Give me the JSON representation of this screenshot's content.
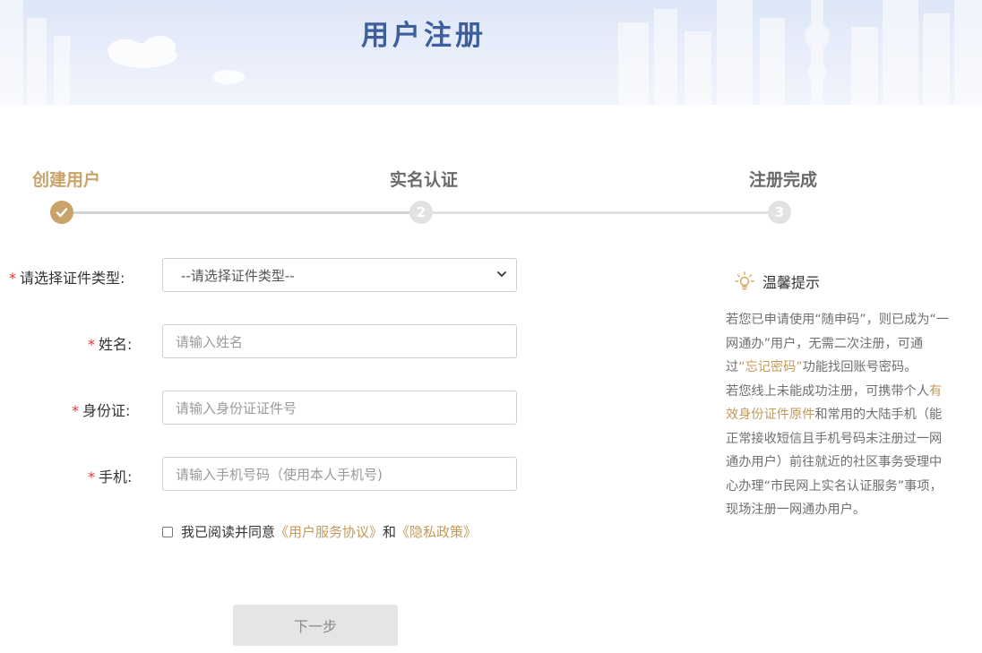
{
  "header": {
    "title": "用户注册"
  },
  "steps": [
    {
      "label": "创建用户",
      "num": "1",
      "state": "done"
    },
    {
      "label": "实名认证",
      "num": "2",
      "state": "pending"
    },
    {
      "label": "注册完成",
      "num": "3",
      "state": "pending"
    }
  ],
  "form": {
    "required_mark": "*",
    "id_type": {
      "label": "请选择证件类型:",
      "value": "--请选择证件类型--"
    },
    "name": {
      "label": "姓名:",
      "placeholder": "请输入姓名"
    },
    "id_number": {
      "label": "身份证:",
      "placeholder": "请输入身份证证件号"
    },
    "phone": {
      "label": "手机:",
      "placeholder": "请输入手机号码（使用本人手机号)"
    },
    "agreement": {
      "prefix": "我已阅读并同意",
      "terms_link": "《用户服务协议》",
      "and": "和",
      "privacy_link": "《隐私政策》",
      "checked": false
    },
    "next_button": "下一步"
  },
  "tips": {
    "title": "温馨提示",
    "para1_a": "若您已申请使用“随申码”，则已成为“一网通办”用户，无需二次注册，可通过",
    "para1_link": "“忘记密码”",
    "para1_b": "功能找回账号密码。",
    "para2_a": "若您线上未能成功注册，可携带个人",
    "para2_link": "有效身份证件原件",
    "para2_b": "和常用的大陆手机（能正常接收短信且手机号码未注册过一网通办用户）前往就近的社区事务受理中心办理“市民网上实名认证服务”事项，现场注册一网通办用户。"
  },
  "colors": {
    "accent_gold": "#c9a36a",
    "title_blue": "#3d5f9d",
    "required_red": "#e0362c"
  }
}
